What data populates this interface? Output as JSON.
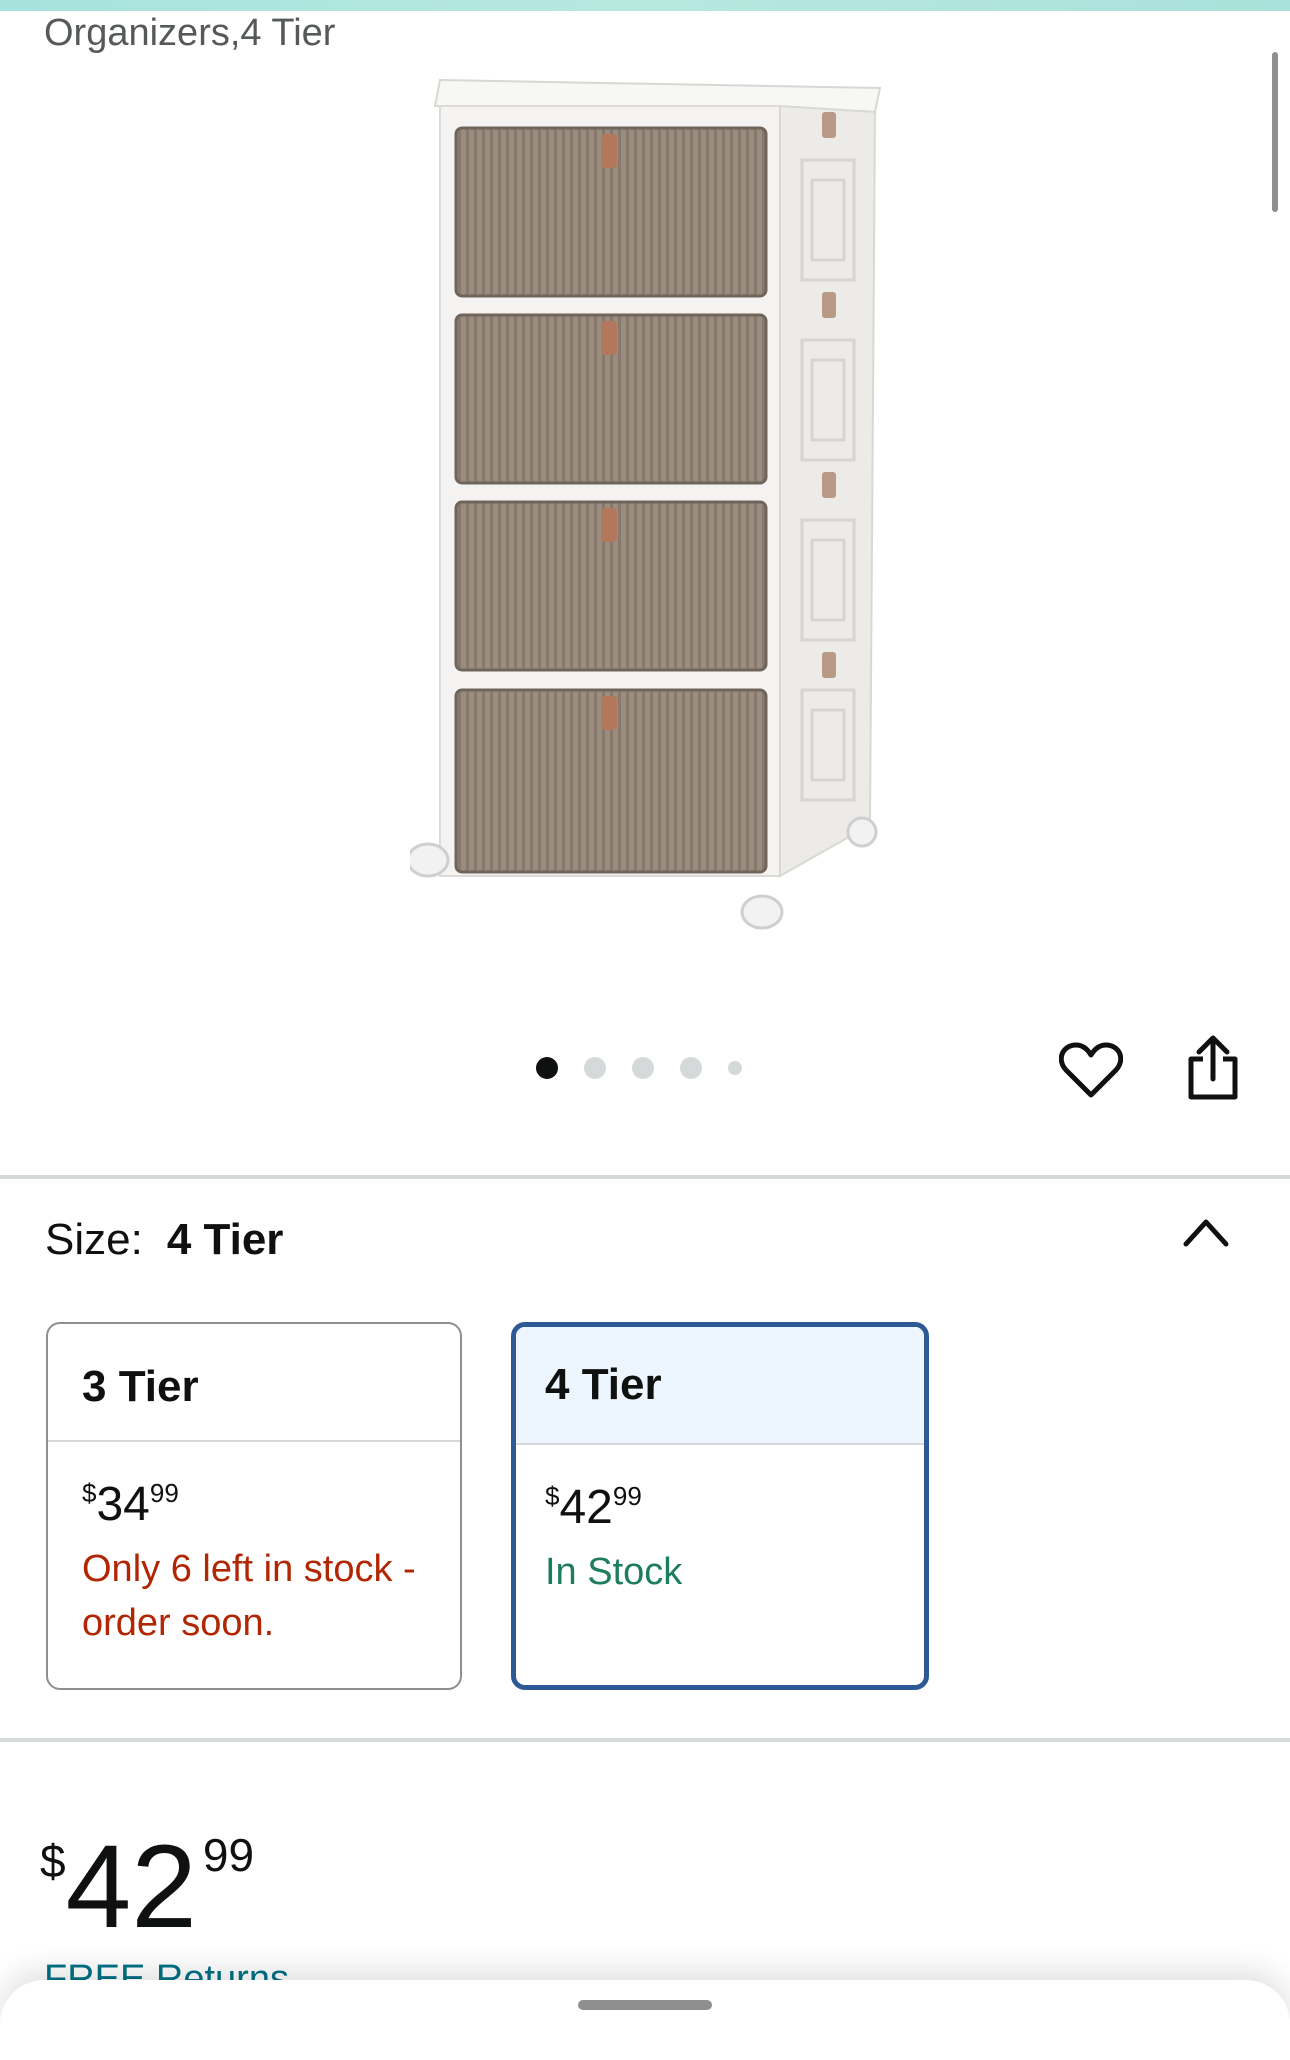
{
  "header": {
    "title_fragment": "Organizers,4 Tier"
  },
  "gallery": {
    "image_count": 5,
    "active_index": 0
  },
  "icons": {
    "favorite": "heart-icon",
    "share": "share-icon",
    "collapse": "chevron-up-icon"
  },
  "size": {
    "label": "Size:",
    "selected": "4 Tier",
    "options": [
      {
        "name": "3 Tier",
        "currency": "$",
        "whole": "34",
        "fraction": "99",
        "stock": "Only 6 left in stock - order soon.",
        "stock_color": "#b12704"
      },
      {
        "name": "4 Tier",
        "currency": "$",
        "whole": "42",
        "fraction": "99",
        "stock": "In Stock",
        "stock_color": "#1d7d5e"
      }
    ]
  },
  "price": {
    "currency": "$",
    "whole": "42",
    "fraction": "99"
  },
  "shipping": {
    "free_returns": "FREE Returns"
  },
  "colors": {
    "selected_border": "#2d5a94",
    "selected_bg": "#edf6ff",
    "link": "#007185"
  }
}
